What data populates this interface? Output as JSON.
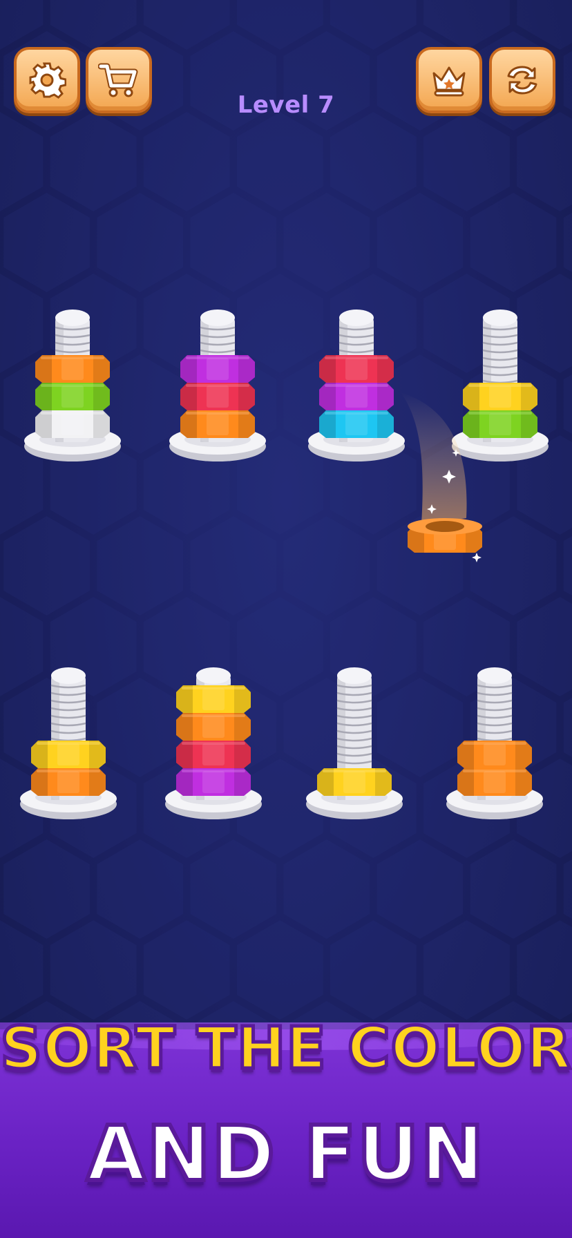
{
  "hud": {
    "level_label": "Level 7",
    "settings_icon": "gear-icon",
    "shop_icon": "cart-icon",
    "ranking_icon": "crown-icon",
    "restart_icon": "swap-arrows-icon"
  },
  "colors": {
    "orange": "#ff8a1c",
    "green": "#7ed321",
    "white": "#f2f2f4",
    "purple": "#c02fe0",
    "red": "#ee3353",
    "blue": "#1ec6f2",
    "yellow": "#ffd21f"
  },
  "board": {
    "pegs": [
      {
        "nuts": [
          "white",
          "green",
          "orange"
        ]
      },
      {
        "nuts": [
          "orange",
          "red",
          "purple"
        ]
      },
      {
        "nuts": [
          "blue",
          "purple",
          "red"
        ]
      },
      {
        "nuts": [
          "green",
          "yellow"
        ]
      },
      {
        "nuts": [
          "orange",
          "yellow"
        ]
      },
      {
        "nuts": [
          "purple",
          "red",
          "orange",
          "yellow"
        ]
      },
      {
        "nuts": [
          "yellow"
        ]
      },
      {
        "nuts": [
          "orange",
          "orange"
        ]
      }
    ],
    "flying_nut": "orange"
  },
  "banner": {
    "line1": "SORT THE COLOR",
    "line2": "AND FUN"
  }
}
